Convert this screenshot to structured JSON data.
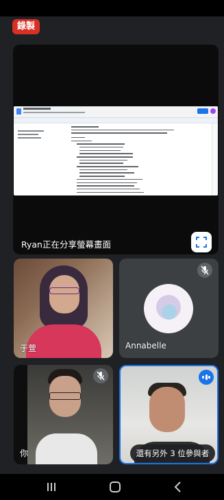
{
  "recording_badge": "錄製",
  "share": {
    "label": "Ryan正在分享螢幕畫面"
  },
  "participants": [
    {
      "name": "于萱",
      "muted": false
    },
    {
      "name": "Annabelle",
      "muted": true
    },
    {
      "name": "你",
      "muted": true
    },
    {
      "name": "",
      "speaking": true
    }
  ],
  "more_participants": "還有另外 3 位參與者",
  "colors": {
    "record_red": "#d93025",
    "accent_blue": "#1a73e8",
    "tile_bg": "#3c4043",
    "page_bg": "#202124"
  },
  "icons": {
    "fullscreen": "fullscreen-icon",
    "mic_off": "mic-off-icon",
    "speaking": "audio-level-icon",
    "nav_recents": "recents-icon",
    "nav_home": "home-icon",
    "nav_back": "back-icon"
  }
}
